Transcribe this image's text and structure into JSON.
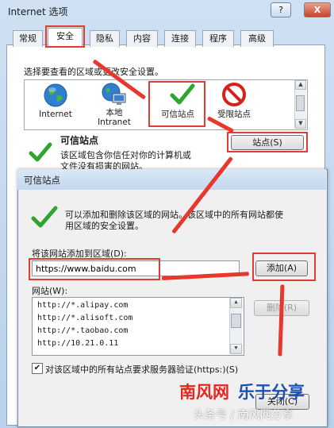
{
  "window": {
    "title": "Internet 选项",
    "help_btn": "?",
    "close_btn": "X"
  },
  "tabs": [
    "常规",
    "安全",
    "隐私",
    "内容",
    "连接",
    "程序",
    "高级"
  ],
  "security": {
    "zone_caption": "选择要查看的区域或更改安全设置。",
    "zones": [
      {
        "label": "Internet",
        "icon": "globe-icon"
      },
      {
        "label": "本地\nIntranet",
        "icon": "intranet-icon"
      },
      {
        "label": "可信站点",
        "icon": "green-check-icon"
      },
      {
        "label": "受限站点",
        "icon": "restricted-icon"
      }
    ],
    "zone_title": "可信站点",
    "zone_desc_line1": "该区域包含你信任对你的计算机或",
    "zone_desc_line2": "文件没有损害的网站。",
    "sites_button": "站点(S)"
  },
  "trusted_dialog": {
    "title": "可信站点",
    "desc_line1": "可以添加和删除该区域的网站。该区域中的所有网站都使",
    "desc_line2": "用区域的安全设置。",
    "add_label": "将该网站添加到区域(D):",
    "add_value": "https://www.baidu.com",
    "add_button": "添加(A)",
    "list_label": "网站(W):",
    "sites": [
      "http://*.alipay.com",
      "http://*.alisoft.com",
      "http://*.taobao.com",
      "http://10.21.0.11"
    ],
    "remove_button": "删除(R)",
    "verify_label": "对该区域中的所有站点要求服务器验证(https:)(S)",
    "close_button": "关闭(C)"
  },
  "watermark": {
    "brand_red": "南风网",
    "brand_blue": "乐于分享",
    "small": "头条号 / 南风网分享"
  },
  "colors": {
    "annotation_red": "#e03c31",
    "brand_red": "#e8251c",
    "brand_blue": "#1d4fae"
  }
}
